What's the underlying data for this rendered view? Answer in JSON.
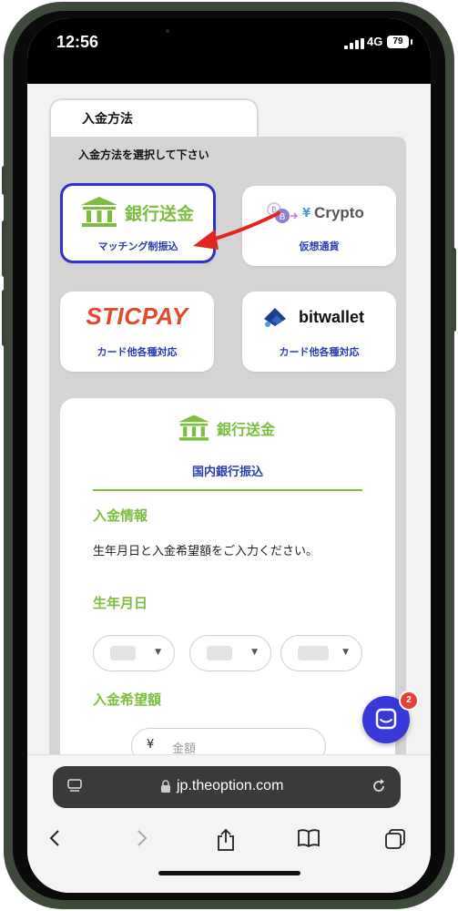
{
  "status_bar": {
    "time": "12:56",
    "network": "4G",
    "battery": "79"
  },
  "tab": {
    "label": "入金方法"
  },
  "instruction": "入金方法を選択して下さい",
  "methods": [
    {
      "name": "銀行送金",
      "subtitle": "マッチング制振込",
      "selected": true,
      "icon": "bank-icon"
    },
    {
      "name": "Crypto",
      "yen": "¥",
      "subtitle": "仮想通貨",
      "selected": false,
      "icon": "crypto-icon"
    },
    {
      "name": "STICPAY",
      "subtitle": "カード他各種対応",
      "selected": false,
      "icon": "sticpay-logo"
    },
    {
      "name": "bitwallet",
      "subtitle": "カード他各種対応",
      "selected": false,
      "icon": "bitwallet-icon"
    }
  ],
  "form": {
    "logo_text": "銀行送金",
    "subtitle": "国内銀行振込",
    "section_info": "入金情報",
    "description": "生年月日と入金希望額をご入力ください。",
    "section_birthday": "生年月日",
    "section_amount": "入金希望額",
    "currency_symbol": "¥",
    "amount_placeholder": "金額"
  },
  "chat": {
    "badge": "2"
  },
  "browser": {
    "url": "jp.theoption.com"
  },
  "colors": {
    "accent_green": "#7dbd3f",
    "select_blue": "#2f32c8",
    "link_blue": "#2a3fb0",
    "sticpay_red": "#e2492c",
    "arrow_red": "#e0261e",
    "chat_blue": "#3838d8"
  }
}
